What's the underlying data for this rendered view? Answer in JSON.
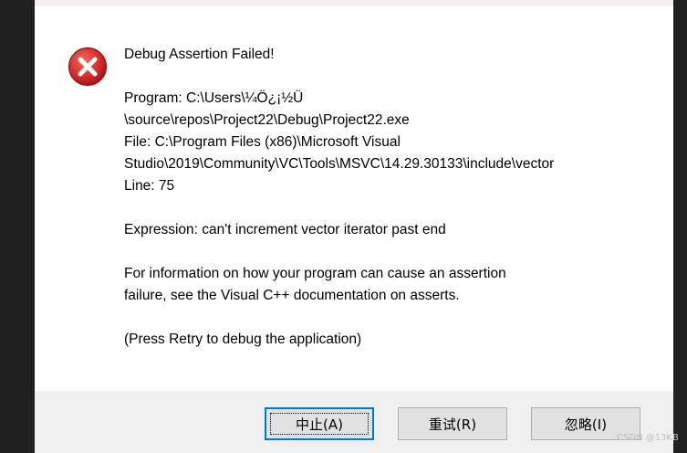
{
  "dialog": {
    "message_lines": [
      "Debug Assertion Failed!",
      "",
      "Program: C:\\Users\\¼Ö¿¡½Ü",
      "\\source\\repos\\Project22\\Debug\\Project22.exe",
      "File: C:\\Program Files (x86)\\Microsoft Visual",
      "Studio\\2019\\Community\\VC\\Tools\\MSVC\\14.29.30133\\include\\vector",
      "Line: 75",
      "",
      "Expression: can't increment vector iterator past end",
      "",
      "For information on how your program can cause an assertion",
      "failure, see the Visual C++ documentation on asserts.",
      "",
      "(Press Retry to debug the application)"
    ],
    "icon": "error-x-icon"
  },
  "buttons": {
    "abort": "中止(A)",
    "retry": "重试(R)",
    "ignore": "忽略(I)"
  },
  "watermark": "CSDN @13KB",
  "colors": {
    "error_red": "#d9322e",
    "focus_blue": "#0078d7"
  }
}
